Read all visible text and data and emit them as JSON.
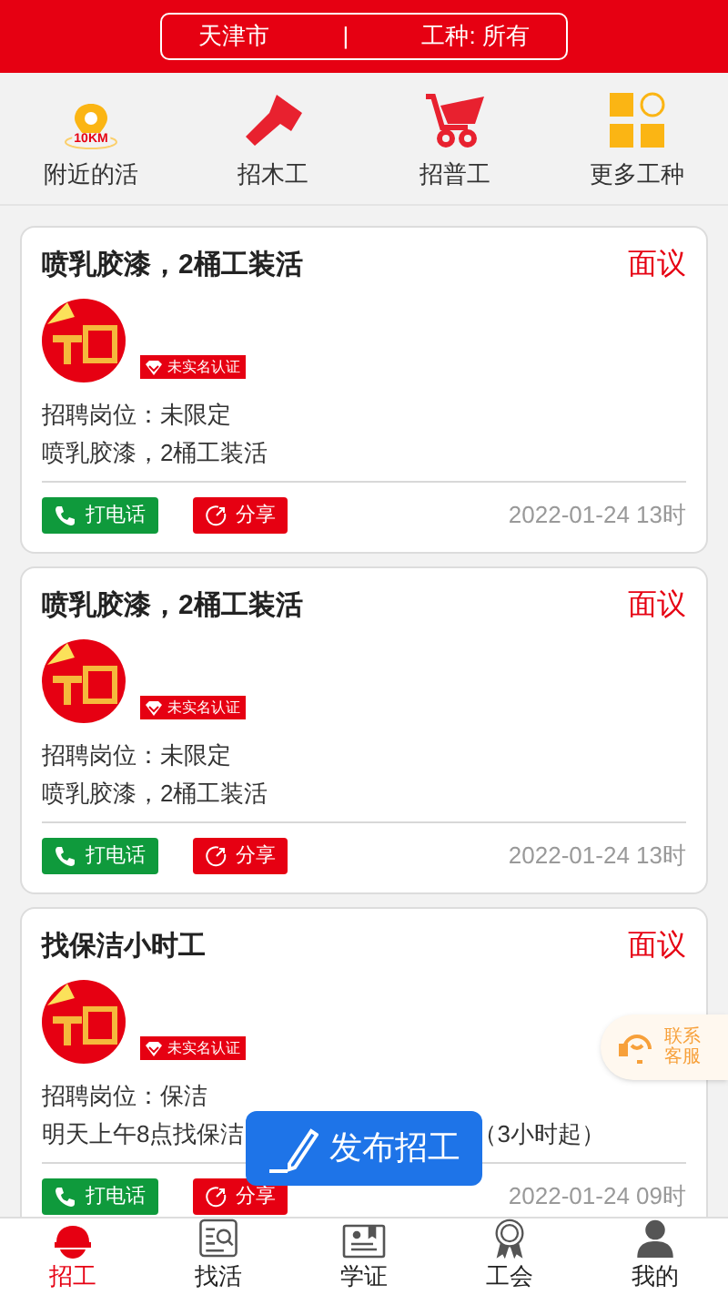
{
  "header": {
    "city": "天津市",
    "separator": "|",
    "trade_filter": "工种: 所有"
  },
  "categories": [
    {
      "kind": "nearby",
      "label": "附近的活",
      "badge": "10KM"
    },
    {
      "kind": "hammer",
      "label": "招木工"
    },
    {
      "kind": "cart",
      "label": "招普工"
    },
    {
      "kind": "grid",
      "label": "更多工种"
    }
  ],
  "jobs": [
    {
      "title": "喷乳胶漆，2桶工装活",
      "pay": "面议",
      "verify_badge": "未实名认证",
      "position": "招聘岗位：未限定",
      "description": [
        "喷乳胶漆，2桶工装活"
      ],
      "call_button": "打电话",
      "share_button": "分享",
      "time": "2022-01-24 13时"
    },
    {
      "title": "喷乳胶漆，2桶工装活",
      "pay": "面议",
      "verify_badge": "未实名认证",
      "position": "招聘岗位：未限定",
      "description": [
        "喷乳胶漆，2桶工装活"
      ],
      "call_button": "打电话",
      "share_button": "分享",
      "time": "2022-01-24 13时"
    },
    {
      "title": "找保洁小时工",
      "pay": "面议",
      "verify_badge": "未实名认证",
      "position": "招聘岗位：保洁",
      "description": [
        "明天上午8点找保洁",
        "（3小时起）"
      ],
      "call_button": "打电话",
      "share_button": "分享",
      "time": "2022-01-24 09时"
    }
  ],
  "contact_button": [
    "联系",
    "客服"
  ],
  "publish_button": "发布招工",
  "tab_bar": [
    {
      "kind": "helmet",
      "label": "招工",
      "selected": true
    },
    {
      "kind": "search-doc",
      "label": "找活",
      "selected": false
    },
    {
      "kind": "certificate",
      "label": "学证",
      "selected": false
    },
    {
      "kind": "medal",
      "label": "工会",
      "selected": false
    },
    {
      "kind": "person",
      "label": "我的",
      "selected": false
    }
  ]
}
